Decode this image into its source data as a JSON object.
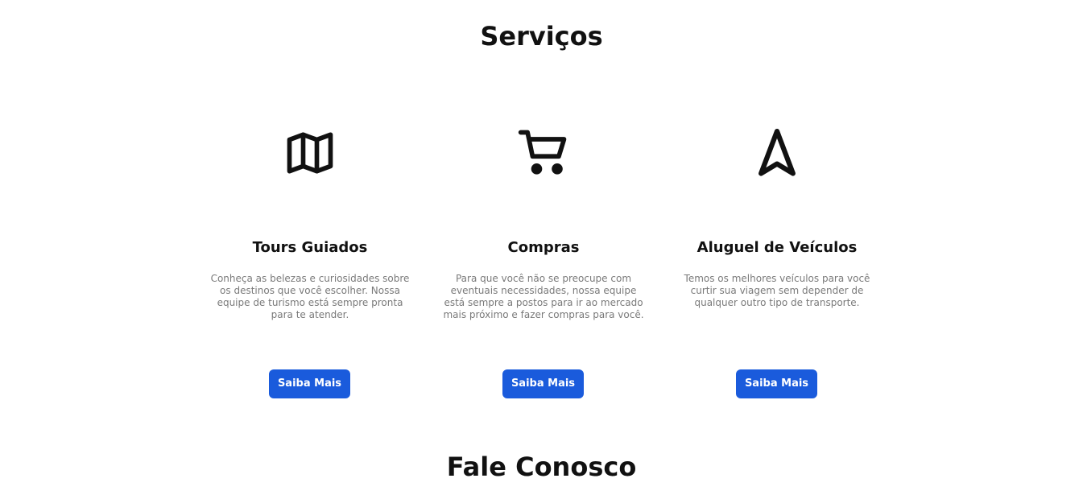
{
  "services": {
    "title": "Serviços",
    "cards": [
      {
        "icon": "map-icon",
        "title": "Tours Guiados",
        "description": "Conheça as belezas e curiosidades sobre os destinos que você escolher. Nossa equipe de turismo está sempre pronta para te atender.",
        "button_label": "Saiba Mais"
      },
      {
        "icon": "shopping-cart-icon",
        "title": "Compras",
        "description": "Para que você não se preocupe com eventuais necessidades, nossa equipe está sempre a postos para ir ao mercado mais próximo e fazer compras para você.",
        "button_label": "Saiba Mais"
      },
      {
        "icon": "navigation-icon",
        "title": "Aluguel de Veículos",
        "description": "Temos os melhores veículos para você curtir sua viagem sem depender de qualquer outro tipo de transporte.",
        "button_label": "Saiba Mais"
      }
    ]
  },
  "contact": {
    "title": "Fale Conosco"
  },
  "colors": {
    "button": "#1a5bdc",
    "text": "#111111",
    "muted_text": "#7a7a7a"
  }
}
